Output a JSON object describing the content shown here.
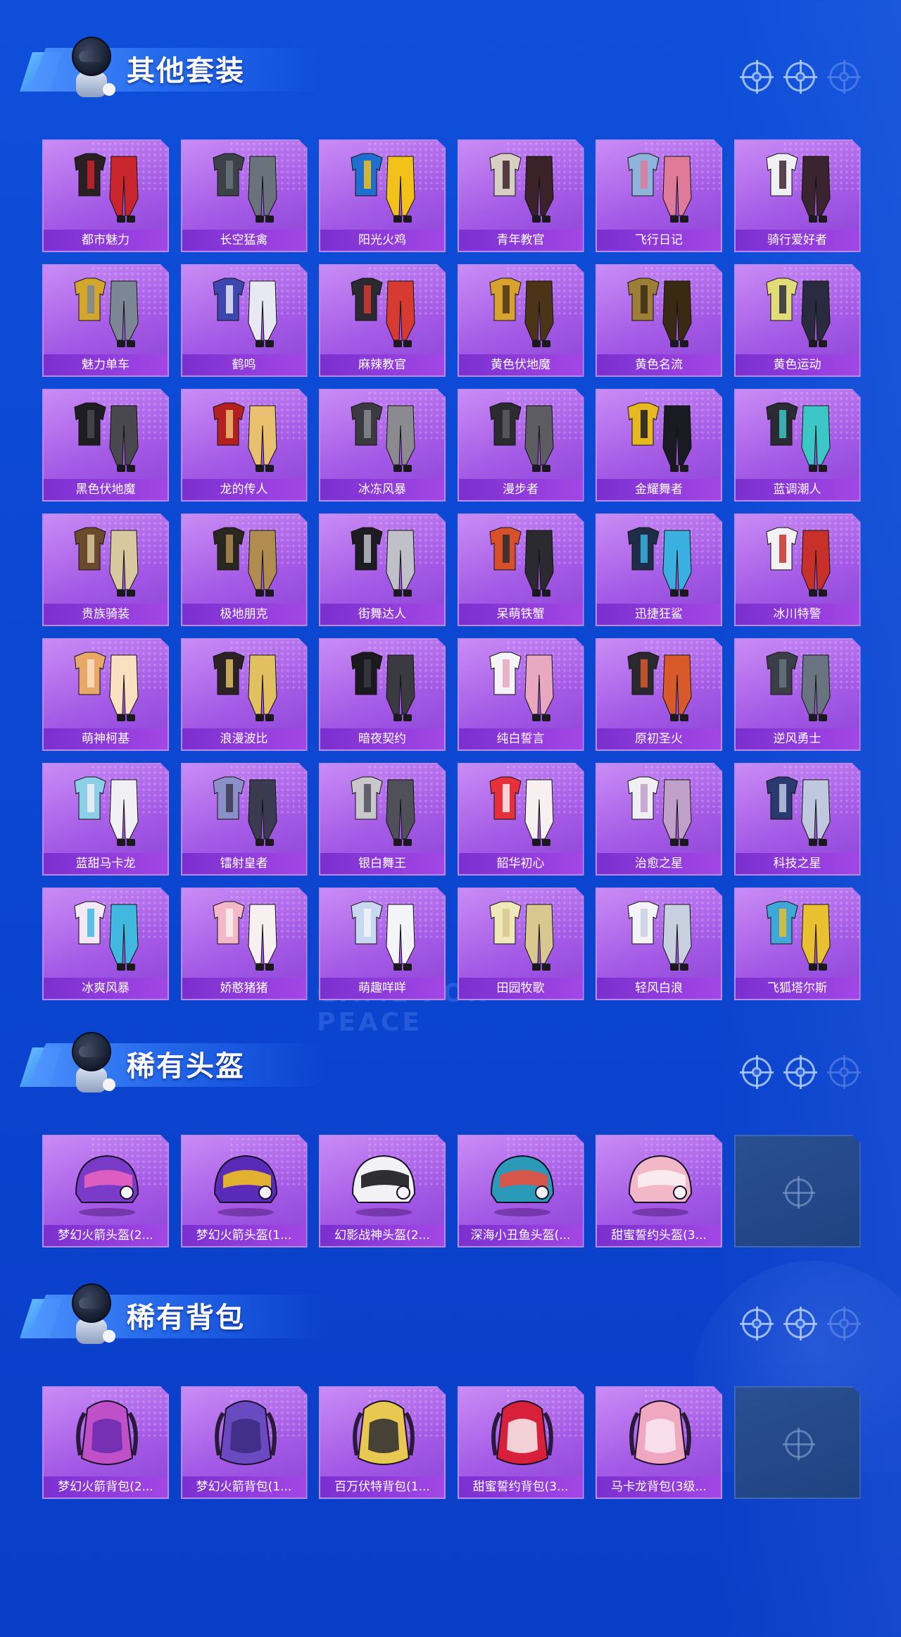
{
  "sections": [
    {
      "title": "其他套装",
      "kind": "outfit",
      "items": [
        {
          "label": "都市魅力",
          "icon": "outfit-icon",
          "color": "#2a2024",
          "accent": "#c9252d"
        },
        {
          "label": "长空猛禽",
          "icon": "outfit-icon",
          "color": "#3c4248",
          "accent": "#6a737c"
        },
        {
          "label": "阳光火鸡",
          "icon": "outfit-icon",
          "color": "#1f6fd1",
          "accent": "#f2c21a"
        },
        {
          "label": "青年教官",
          "icon": "outfit-icon",
          "color": "#d8cfc4",
          "accent": "#3b2228"
        },
        {
          "label": "飞行日记",
          "icon": "outfit-icon",
          "color": "#8fb4dc",
          "accent": "#e07a9a"
        },
        {
          "label": "骑行爱好者",
          "icon": "outfit-icon",
          "color": "#f0f0f2",
          "accent": "#3a2430"
        },
        {
          "label": "魅力单车",
          "icon": "outfit-icon",
          "color": "#d3a72b",
          "accent": "#7b8794"
        },
        {
          "label": "鹤鸣",
          "icon": "outfit-icon",
          "color": "#3e46b0",
          "accent": "#e8e8f2"
        },
        {
          "label": "麻辣教官",
          "icon": "outfit-icon",
          "color": "#2a2a30",
          "accent": "#d63a30"
        },
        {
          "label": "黄色伏地魔",
          "icon": "outfit-icon",
          "color": "#d8a22e",
          "accent": "#4b3418"
        },
        {
          "label": "黄色名流",
          "icon": "outfit-icon",
          "color": "#9c7e36",
          "accent": "#3a2a14"
        },
        {
          "label": "黄色运动",
          "icon": "outfit-icon",
          "color": "#e2dc78",
          "accent": "#2a2a40"
        },
        {
          "label": "黑色伏地魔",
          "icon": "outfit-icon",
          "color": "#1e1e22",
          "accent": "#48484e"
        },
        {
          "label": "龙的传人",
          "icon": "outfit-icon",
          "color": "#b3201f",
          "accent": "#e8c070"
        },
        {
          "label": "冰冻风暴",
          "icon": "outfit-icon",
          "color": "#3a3a40",
          "accent": "#8a8a90"
        },
        {
          "label": "漫步者",
          "icon": "outfit-icon",
          "color": "#2c2c30",
          "accent": "#5c5c62"
        },
        {
          "label": "金耀舞者",
          "icon": "outfit-icon",
          "color": "#e8b820",
          "accent": "#1a1a22"
        },
        {
          "label": "蓝调潮人",
          "icon": "outfit-icon",
          "color": "#2b2b34",
          "accent": "#3cc6c6"
        },
        {
          "label": "贵族骑装",
          "icon": "outfit-icon",
          "color": "#6a4a2a",
          "accent": "#d8c8a0"
        },
        {
          "label": "极地朋克",
          "icon": "outfit-icon",
          "color": "#2a2620",
          "accent": "#b08c50"
        },
        {
          "label": "街舞达人",
          "icon": "outfit-icon",
          "color": "#1c1c22",
          "accent": "#c0c0c8"
        },
        {
          "label": "呆萌铁蟹",
          "icon": "outfit-icon",
          "color": "#d8502a",
          "accent": "#2a2a30"
        },
        {
          "label": "迅捷狂鲨",
          "icon": "outfit-icon",
          "color": "#1e2e48",
          "accent": "#3ab0e0"
        },
        {
          "label": "冰川特警",
          "icon": "outfit-icon",
          "color": "#f2f2f4",
          "accent": "#c8302a"
        },
        {
          "label": "萌神柯基",
          "icon": "outfit-icon",
          "color": "#e8a868",
          "accent": "#f8e0c0"
        },
        {
          "label": "浪漫波比",
          "icon": "outfit-icon",
          "color": "#2a2224",
          "accent": "#e0c060"
        },
        {
          "label": "暗夜契约",
          "icon": "outfit-icon",
          "color": "#1a1a1e",
          "accent": "#3a3a40"
        },
        {
          "label": "纯白誓言",
          "icon": "outfit-icon",
          "color": "#f4f4f6",
          "accent": "#e8a8c0"
        },
        {
          "label": "原初圣火",
          "icon": "outfit-icon",
          "color": "#2a2a2e",
          "accent": "#d85a2a"
        },
        {
          "label": "逆风勇士",
          "icon": "outfit-icon",
          "color": "#3a3e46",
          "accent": "#6a7480"
        },
        {
          "label": "蓝甜马卡龙",
          "icon": "outfit-icon",
          "color": "#8cd0e8",
          "accent": "#f0f0f4"
        },
        {
          "label": "镭射皇者",
          "icon": "outfit-icon",
          "color": "#8c90c8",
          "accent": "#3a3a50"
        },
        {
          "label": "银白舞王",
          "icon": "outfit-icon",
          "color": "#c8c8cc",
          "accent": "#50505a"
        },
        {
          "label": "韶华初心",
          "icon": "outfit-icon",
          "color": "#e8303a",
          "accent": "#f8f0f0"
        },
        {
          "label": "治愈之星",
          "icon": "outfit-icon",
          "color": "#f0f0f4",
          "accent": "#c0a0c8"
        },
        {
          "label": "科技之星",
          "icon": "outfit-icon",
          "color": "#2a3a70",
          "accent": "#c0c8e0"
        },
        {
          "label": "冰爽风暴",
          "icon": "outfit-icon",
          "color": "#f4e8f4",
          "accent": "#40b8e0"
        },
        {
          "label": "娇憨猪猪",
          "icon": "outfit-icon",
          "color": "#f4b8c8",
          "accent": "#f8f0f0"
        },
        {
          "label": "萌趣咩咩",
          "icon": "outfit-icon",
          "color": "#c8d8f0",
          "accent": "#f4f4f8"
        },
        {
          "label": "田园牧歌",
          "icon": "outfit-icon",
          "color": "#f0e8b8",
          "accent": "#d8c890"
        },
        {
          "label": "轻风白浪",
          "icon": "outfit-icon",
          "color": "#f4f4f8",
          "accent": "#c8d0e0"
        },
        {
          "label": "飞狐塔尔斯",
          "icon": "outfit-icon",
          "color": "#40a8d8",
          "accent": "#e8c030"
        }
      ]
    },
    {
      "title": "稀有头盔",
      "kind": "helmet",
      "items": [
        {
          "label": "梦幻火箭头盔(2...",
          "icon": "helmet-icon",
          "color": "#7a3cc8",
          "accent": "#e860c0"
        },
        {
          "label": "梦幻火箭头盔(1...",
          "icon": "helmet-icon",
          "color": "#5a2ab8",
          "accent": "#f0c020"
        },
        {
          "label": "幻影战神头盔(2...",
          "icon": "helmet-icon",
          "color": "#f2f2f4",
          "accent": "#1a1a1e"
        },
        {
          "label": "深海小丑鱼头盔(...",
          "icon": "helmet-icon",
          "color": "#2a9ab8",
          "accent": "#e85040"
        },
        {
          "label": "甜蜜誓约头盔(3...",
          "icon": "helmet-icon",
          "color": "#f2b8c8",
          "accent": "#f8f0f2"
        }
      ]
    },
    {
      "title": "稀有背包",
      "kind": "backpack",
      "items": [
        {
          "label": "梦幻火箭背包(2...",
          "icon": "backpack-icon",
          "color": "#c050c8",
          "accent": "#6a2ab0"
        },
        {
          "label": "梦幻火箭背包(1...",
          "icon": "backpack-icon",
          "color": "#6a4ac0",
          "accent": "#3a2a80"
        },
        {
          "label": "百万伏特背包(1...",
          "icon": "backpack-icon",
          "color": "#e8c850",
          "accent": "#2a2a30"
        },
        {
          "label": "甜蜜誓约背包(3...",
          "icon": "backpack-icon",
          "color": "#d8203a",
          "accent": "#f8f0f2"
        },
        {
          "label": "马卡龙背包(3级...",
          "icon": "backpack-icon",
          "color": "#f0a8c0",
          "accent": "#f8e8ee"
        }
      ]
    }
  ],
  "watermark": "GAME FOR PEACE"
}
